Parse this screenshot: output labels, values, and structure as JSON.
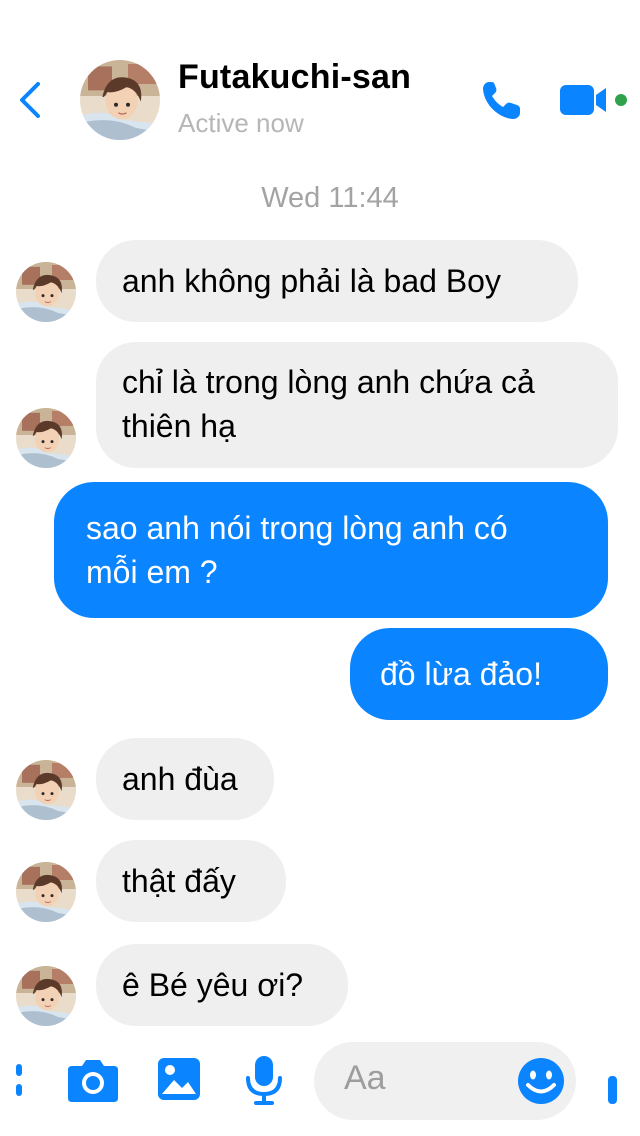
{
  "header": {
    "contact_name": "Futakuchi-san",
    "status": "Active now",
    "icons": {
      "back": "chevron-left-icon",
      "call": "phone-icon",
      "video": "video-camera-icon",
      "online": "online-dot"
    }
  },
  "timestamp": "Wed 11:44",
  "messages": [
    {
      "from": "contact",
      "text": "anh không phải là bad Boy"
    },
    {
      "from": "contact",
      "lines": [
        "chỉ là trong lòng anh chứa cả",
        "thiên hạ"
      ]
    },
    {
      "from": "me",
      "lines": [
        "sao anh nói trong lòng anh có",
        "mỗi em ?"
      ]
    },
    {
      "from": "me",
      "text": "đồ lừa đảo!"
    },
    {
      "from": "contact",
      "text": "anh đùa"
    },
    {
      "from": "contact",
      "text": "thật đấy"
    },
    {
      "from": "contact",
      "text": "ê Bé yêu ơi?"
    }
  ],
  "composer": {
    "placeholder": "Aa",
    "icons": [
      "more-icon",
      "camera-icon",
      "image-icon",
      "microphone-icon",
      "emoji-icon",
      "like-icon"
    ]
  },
  "colors": {
    "accent": "#0A84FF",
    "incoming_bubble": "#EFEFF0",
    "online": "#31A24C"
  }
}
